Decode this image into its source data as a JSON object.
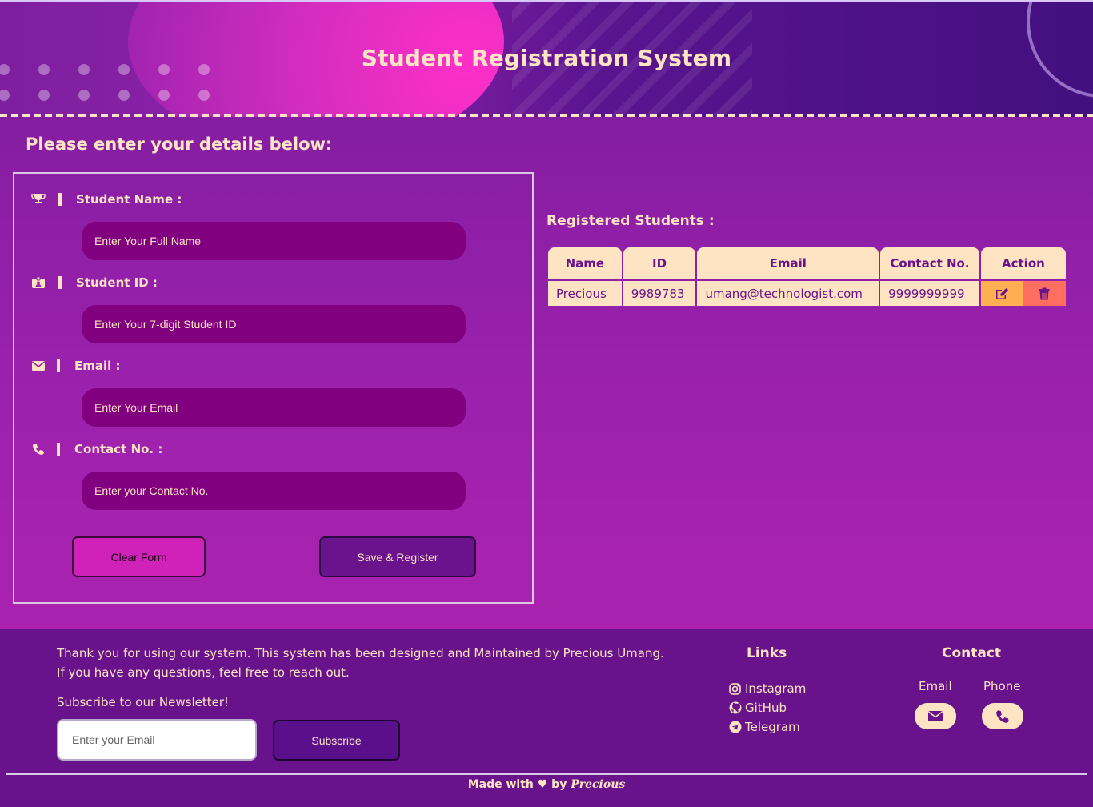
{
  "header": {
    "title": "Student Registration System"
  },
  "form": {
    "heading": "Please enter your details below:",
    "fields": [
      {
        "icon": "trophy-icon",
        "label": "Student Name :",
        "placeholder": "Enter Your Full Name"
      },
      {
        "icon": "id-card-icon",
        "label": "Student ID :",
        "placeholder": "Enter Your 7-digit Student ID"
      },
      {
        "icon": "envelope-icon",
        "label": "Email :",
        "placeholder": "Enter Your Email"
      },
      {
        "icon": "phone-icon",
        "label": "Contact No. :",
        "placeholder": "Enter your Contact No."
      }
    ],
    "clear_label": "Clear Form",
    "save_label": "Save & Register"
  },
  "table": {
    "heading": "Registered Students :",
    "columns": [
      "Name",
      "ID",
      "Email",
      "Contact No.",
      "Action"
    ],
    "rows": [
      {
        "name": "Precious",
        "id": "9989783",
        "email": "umang@technologist.com",
        "contact": "9999999999"
      }
    ],
    "edit_icon": "edit-icon",
    "delete_icon": "trash-icon"
  },
  "footer": {
    "about_line1": "Thank you for using our system. This system has been designed and Maintained by Precious Umang.",
    "about_line2": "If you have any questions, feel free to reach out.",
    "newsletter_label": "Subscribe to our Newsletter!",
    "newsletter_placeholder": "Enter your Email",
    "subscribe_label": "Subscribe",
    "links_title": "Links",
    "links": [
      {
        "icon": "instagram-icon",
        "label": "Instagram"
      },
      {
        "icon": "github-icon",
        "label": "GitHub"
      },
      {
        "icon": "telegram-icon",
        "label": "Telegram"
      }
    ],
    "contact_title": "Contact",
    "contact_email_label": "Email",
    "contact_phone_label": "Phone",
    "made_prefix": "Made with ♥ by",
    "made_author": "Precious"
  },
  "colors": {
    "cream": "#ffe4c4",
    "input_bg": "#800080",
    "footer_bg": "#68138c",
    "edit": "#ffae52",
    "delete": "#ff6f61"
  }
}
